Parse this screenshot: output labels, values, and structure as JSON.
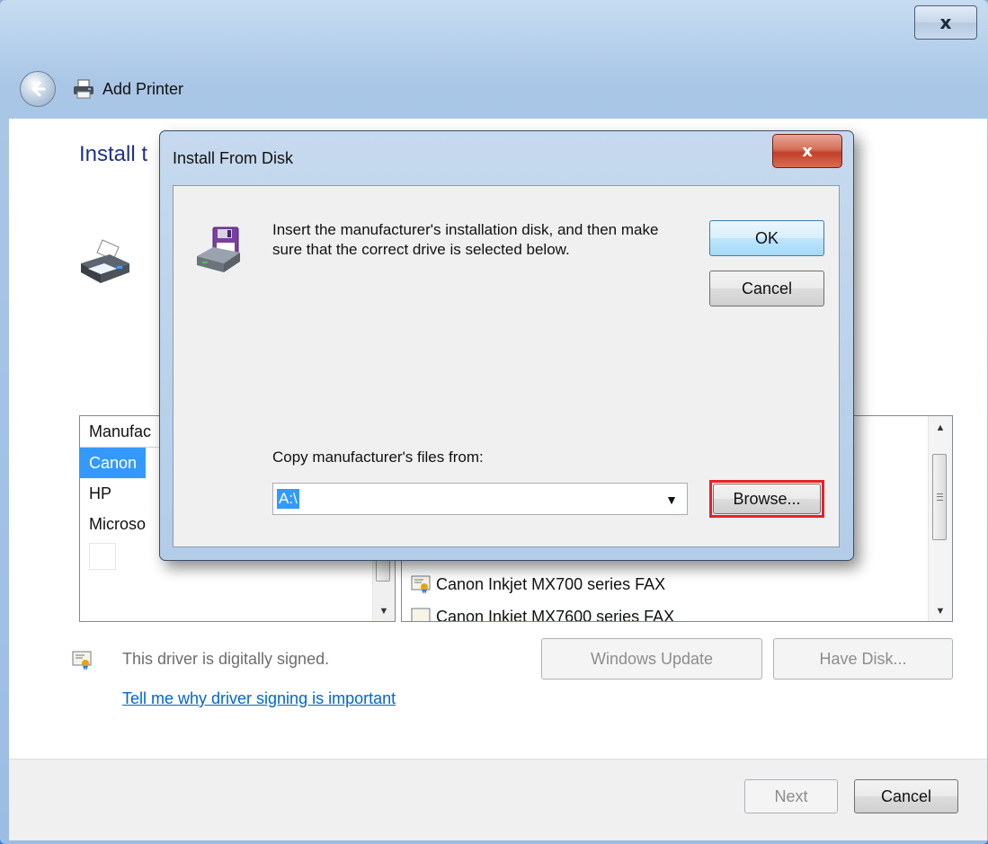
{
  "window": {
    "title": "Add Printer",
    "close_label": "x"
  },
  "page": {
    "heading": "Install t"
  },
  "manufacturers": {
    "header": "Manufac",
    "items": [
      "Canon",
      "HP",
      "Microso"
    ],
    "selected": "Canon"
  },
  "drivers": {
    "items": [
      "Canon Inkjet MX700 series FAX",
      "Canon Inkjet MX7600 series FAX"
    ]
  },
  "signature": {
    "text": "This driver is digitally signed.",
    "link": "Tell me why driver signing is important"
  },
  "buttons": {
    "windows_update": "Windows Update",
    "have_disk": "Have Disk...",
    "next": "Next",
    "cancel": "Cancel"
  },
  "dialog": {
    "title": "Install From Disk",
    "close_label": "x",
    "instruction": "Insert the manufacturer's installation disk, and then make sure that the correct drive is selected below.",
    "ok": "OK",
    "cancel": "Cancel",
    "copy_label": "Copy manufacturer's files from:",
    "path_value": "A:\\",
    "browse": "Browse..."
  },
  "colors": {
    "heading": "#1e3287",
    "link": "#0066cc",
    "selection": "#3399ff",
    "highlight": "#e8202a"
  }
}
